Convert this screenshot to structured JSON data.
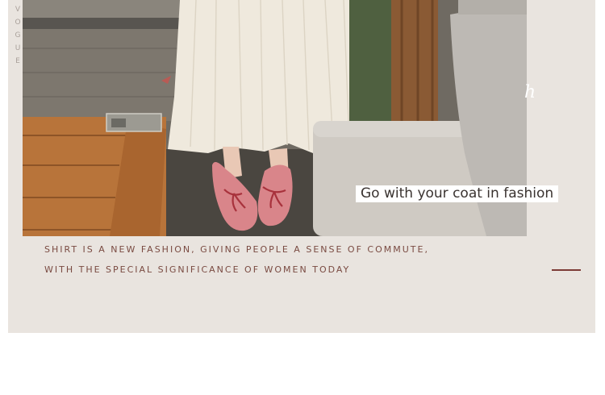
{
  "vertical_word": [
    "V",
    "O",
    "G",
    "U",
    "E"
  ],
  "photo": {
    "colors": {
      "paving": "#7d776e",
      "table_wood": "#b8743a",
      "wall_wood": "#8a5a34",
      "skirt": "#efe9dd",
      "cushion": "#cfcac3",
      "pillow": "#bdb9b4",
      "shoe": "#d9858a",
      "bow": "#a8323c",
      "foliage": "#4f6040"
    }
  },
  "caption": "Go with your coat in fashion",
  "description": {
    "line1": "SHIRT IS A NEW FASHION, GIVING PEOPLE A SENSE OF COMMUTE,",
    "line2": "WITH THE SPECIAL SIGNIFICANCE OF WOMEN TODAY"
  },
  "accent_color": "#7c3b36"
}
